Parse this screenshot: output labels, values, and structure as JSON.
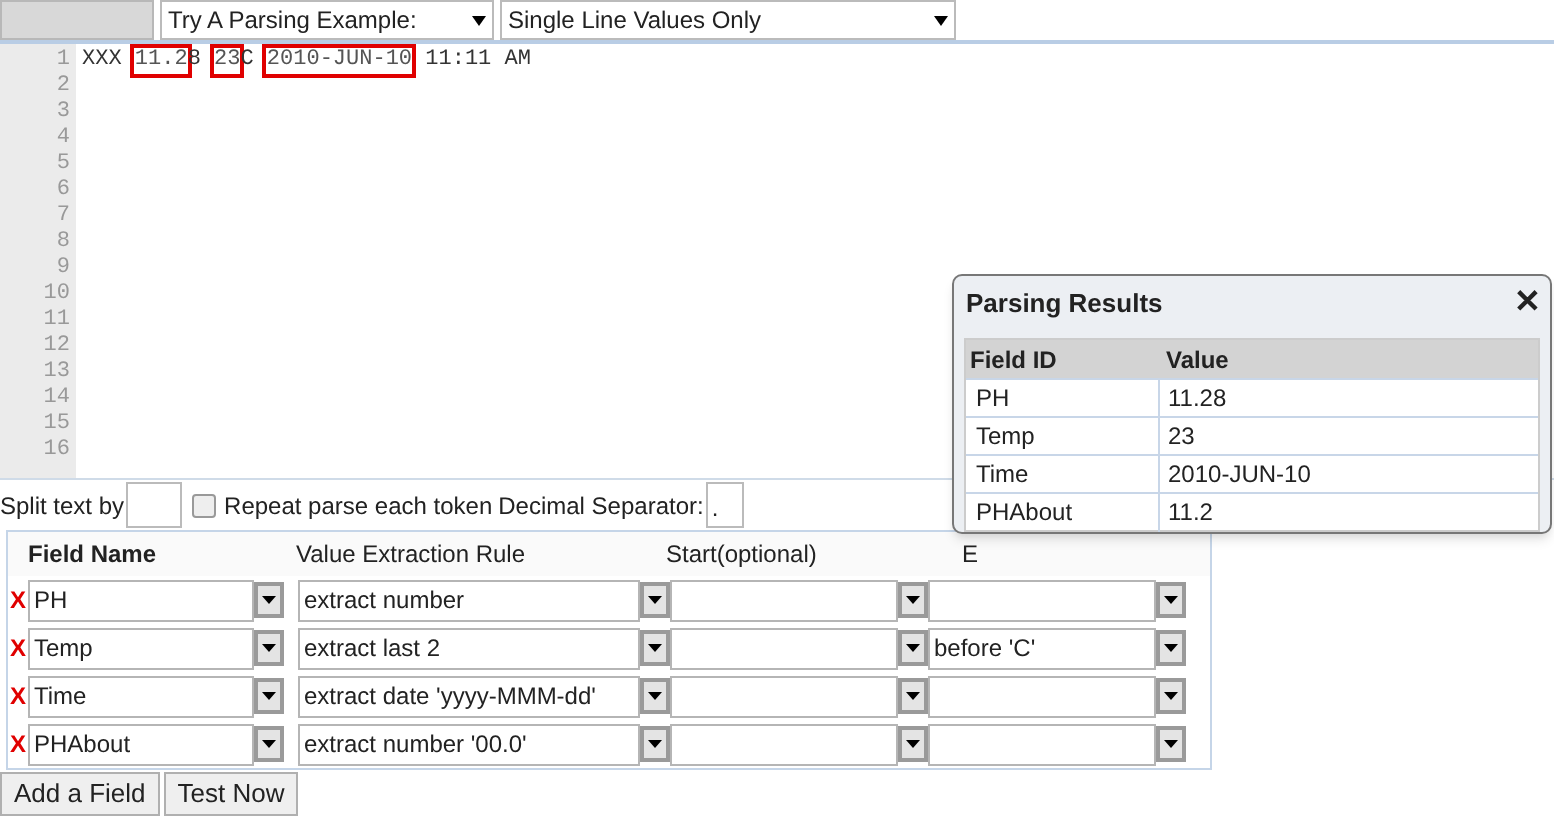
{
  "toolbar": {
    "example_select": "Try A Parsing Example:",
    "mode_select": "Single Line Values Only"
  },
  "editor": {
    "line_numbers": [
      "1",
      "2",
      "3",
      "4",
      "5",
      "6",
      "7",
      "8",
      "9",
      "10",
      "11",
      "12",
      "13",
      "14",
      "15",
      "16"
    ],
    "segments": [
      {
        "text": "XXX ",
        "highlighted": false
      },
      {
        "text": "11.2",
        "highlighted": true
      },
      {
        "text": "8 ",
        "highlighted": false
      },
      {
        "text": "23",
        "highlighted": true
      },
      {
        "text": "C ",
        "highlighted": false
      },
      {
        "text": "2010-JUN-10",
        "highlighted": true
      },
      {
        "text": " 11:11 AM",
        "highlighted": false
      }
    ]
  },
  "options": {
    "split_label": "Split text by",
    "repeat": {
      "label": "Repeat parse each token",
      "checked": false
    },
    "decimal_label": "Decimal Separator:",
    "decimal_value": "."
  },
  "fields": {
    "columns": [
      "Field Name",
      "Value Extraction Rule",
      "Start(optional)",
      "E"
    ],
    "rows": [
      {
        "delete": "X",
        "name": "PH",
        "rule": "extract number"
      },
      {
        "delete": "X",
        "name": "Temp",
        "rule": "extract last 2",
        "end": "before 'C'"
      },
      {
        "delete": "X",
        "name": "Time",
        "rule": "extract date 'yyyy-MMM-dd'"
      },
      {
        "delete": "X",
        "name": "PHAbout",
        "rule": "extract number '00.0'"
      }
    ]
  },
  "buttons": [
    "Add a Field",
    "Test Now"
  ],
  "results": {
    "title": "Parsing Results",
    "close": "✕",
    "columns": [
      "Field ID",
      "Value"
    ],
    "rows": [
      [
        "PH",
        "11.28"
      ],
      [
        "Temp",
        "23"
      ],
      [
        "Time",
        "2010-JUN-10"
      ],
      [
        "PHAbout",
        "11.2"
      ]
    ]
  }
}
